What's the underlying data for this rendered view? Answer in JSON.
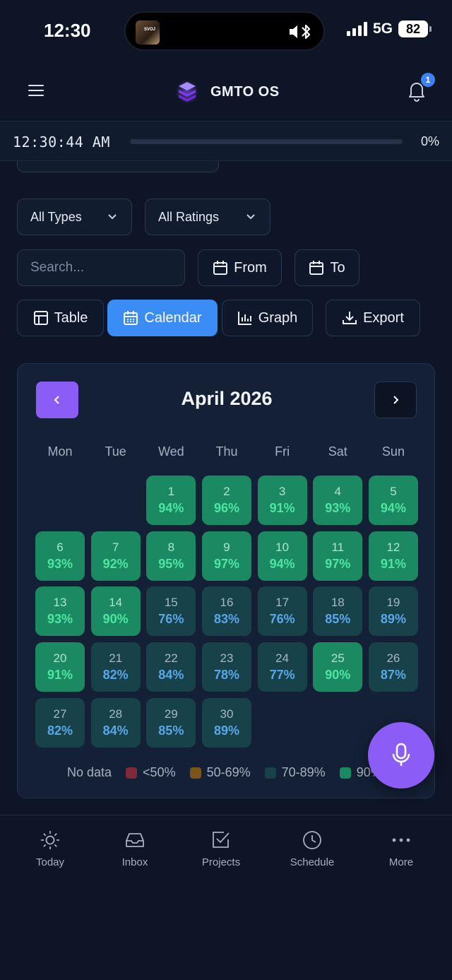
{
  "status_bar": {
    "time": "12:30",
    "network": "5G",
    "battery": "82",
    "island_art_text": "SVOJ"
  },
  "header": {
    "app_name": "GMTO OS",
    "notification_count": "1"
  },
  "timer": {
    "time": "12:30:44 AM",
    "progress_percent": 0,
    "percent_label": "0%"
  },
  "filters": {
    "type_select": "All Types",
    "rating_select": "All Ratings",
    "search_placeholder": "Search...",
    "from_label": "From",
    "to_label": "To"
  },
  "view_buttons": {
    "table": "Table",
    "calendar": "Calendar",
    "graph": "Graph",
    "export": "Export",
    "active": "calendar"
  },
  "calendar": {
    "month_title": "April 2026",
    "weekdays": [
      "Mon",
      "Tue",
      "Wed",
      "Thu",
      "Fri",
      "Sat",
      "Sun"
    ],
    "leading_blanks": 2,
    "days": [
      {
        "day": "1",
        "pct": "94%",
        "level": "hi"
      },
      {
        "day": "2",
        "pct": "96%",
        "level": "hi"
      },
      {
        "day": "3",
        "pct": "91%",
        "level": "hi"
      },
      {
        "day": "4",
        "pct": "93%",
        "level": "hi"
      },
      {
        "day": "5",
        "pct": "94%",
        "level": "hi"
      },
      {
        "day": "6",
        "pct": "93%",
        "level": "hi"
      },
      {
        "day": "7",
        "pct": "92%",
        "level": "hi"
      },
      {
        "day": "8",
        "pct": "95%",
        "level": "hi"
      },
      {
        "day": "9",
        "pct": "97%",
        "level": "hi"
      },
      {
        "day": "10",
        "pct": "94%",
        "level": "hi"
      },
      {
        "day": "11",
        "pct": "97%",
        "level": "hi"
      },
      {
        "day": "12",
        "pct": "91%",
        "level": "hi"
      },
      {
        "day": "13",
        "pct": "93%",
        "level": "hi"
      },
      {
        "day": "14",
        "pct": "90%",
        "level": "hi"
      },
      {
        "day": "15",
        "pct": "76%",
        "level": "mid"
      },
      {
        "day": "16",
        "pct": "83%",
        "level": "mid"
      },
      {
        "day": "17",
        "pct": "76%",
        "level": "mid"
      },
      {
        "day": "18",
        "pct": "85%",
        "level": "mid"
      },
      {
        "day": "19",
        "pct": "89%",
        "level": "mid"
      },
      {
        "day": "20",
        "pct": "91%",
        "level": "hi"
      },
      {
        "day": "21",
        "pct": "82%",
        "level": "mid"
      },
      {
        "day": "22",
        "pct": "84%",
        "level": "mid"
      },
      {
        "day": "23",
        "pct": "78%",
        "level": "mid"
      },
      {
        "day": "24",
        "pct": "77%",
        "level": "mid"
      },
      {
        "day": "25",
        "pct": "90%",
        "level": "hi"
      },
      {
        "day": "26",
        "pct": "87%",
        "level": "mid"
      },
      {
        "day": "27",
        "pct": "82%",
        "level": "mid"
      },
      {
        "day": "28",
        "pct": "84%",
        "level": "mid"
      },
      {
        "day": "29",
        "pct": "85%",
        "level": "mid"
      },
      {
        "day": "30",
        "pct": "89%",
        "level": "mid"
      }
    ],
    "legend": {
      "no_data": "No data",
      "items": [
        {
          "label": "<50%",
          "color": "#7f2a3a"
        },
        {
          "label": "50-69%",
          "color": "#7a5418"
        },
        {
          "label": "70-89%",
          "color": "#17424a"
        },
        {
          "label": "90%+",
          "color": "#1b8a62"
        }
      ]
    }
  },
  "bottom_nav": [
    {
      "label": "Today",
      "icon": "sun-icon"
    },
    {
      "label": "Inbox",
      "icon": "inbox-icon"
    },
    {
      "label": "Projects",
      "icon": "checkbox-icon"
    },
    {
      "label": "Schedule",
      "icon": "clock-icon"
    },
    {
      "label": "More",
      "icon": "more-dots-icon"
    }
  ],
  "colors": {
    "accent_blue": "#3b8cf5",
    "accent_purple": "#8b5cf6",
    "background": "#0d1526"
  }
}
